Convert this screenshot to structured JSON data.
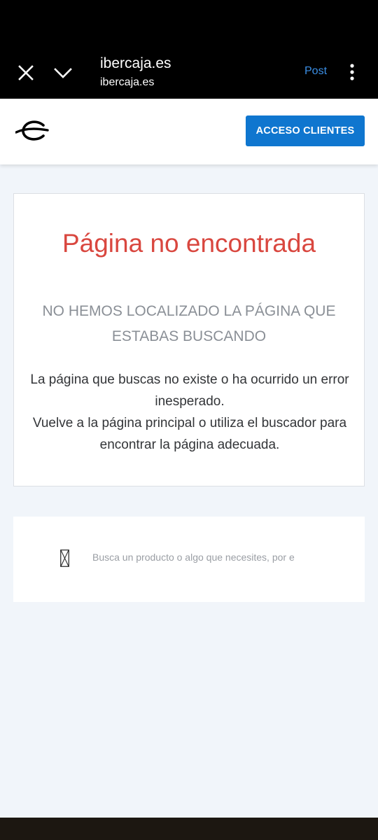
{
  "browser": {
    "title": "ibercaja.es",
    "url": "ibercaja.es",
    "post_label": "Post"
  },
  "header": {
    "access_button": "ACCESO CLIENTES"
  },
  "error": {
    "title": "Página no encontrada",
    "subtitle": "NO HEMOS LOCALIZADO LA PÁGINA QUE ESTABAS BUSCANDO",
    "body_line1": "La página que buscas no existe o ha ocurrido un error inesperado.",
    "body_line2": "Vuelve a la página principal o utiliza el buscador para encontrar la página adecuada."
  },
  "search": {
    "placeholder": "Busca un producto o algo que necesites, por e"
  },
  "icons": {
    "close": "close-icon",
    "chevron": "chevron-down-icon",
    "more": "more-vertical-icon",
    "logo": "ibercaja-logo",
    "search": "search-icon"
  },
  "colors": {
    "browser_bar": "#000000",
    "accent_button": "#0f76cf",
    "error_title": "#d9473f",
    "page_background": "#f1f5fa",
    "post_link": "#3b8fe6"
  }
}
